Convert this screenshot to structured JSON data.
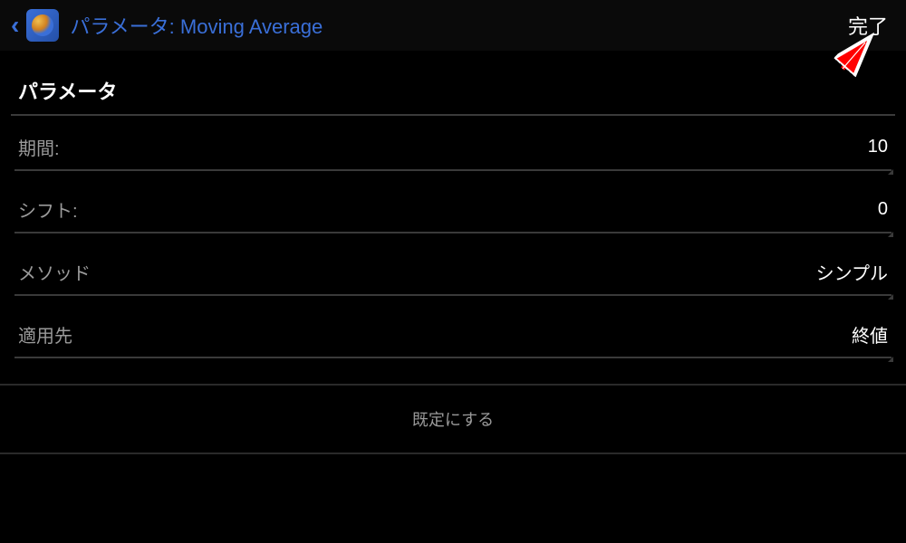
{
  "header": {
    "title": "パラメータ: Moving Average",
    "done_label": "完了"
  },
  "section": {
    "title": "パラメータ"
  },
  "params": {
    "period": {
      "label": "期間:",
      "value": "10"
    },
    "shift": {
      "label": "シフト:",
      "value": "0"
    },
    "method": {
      "label": "メソッド",
      "value": "シンプル"
    },
    "apply_to": {
      "label": "適用先",
      "value": "終値"
    }
  },
  "footer": {
    "reset_label": "既定にする"
  }
}
